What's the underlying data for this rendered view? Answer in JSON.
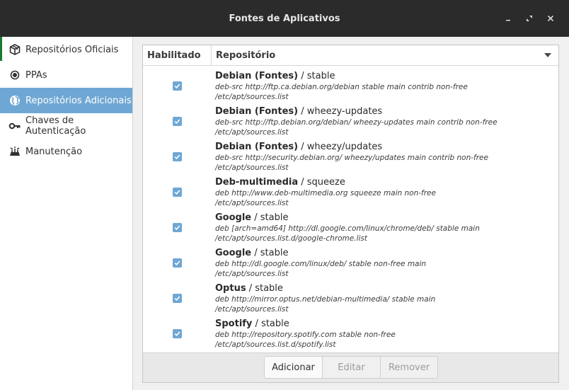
{
  "window": {
    "title": "Fontes de Aplicativos"
  },
  "sidebar": {
    "items": [
      {
        "label": "Repositórios Oficiais",
        "icon": "package-icon",
        "active": false
      },
      {
        "label": "PPAs",
        "icon": "ppa-dot-icon",
        "active": false
      },
      {
        "label": "Repositórios Adicionais",
        "icon": "globe-icon",
        "active": true
      },
      {
        "label": "Chaves de Autenticação",
        "icon": "key-icon",
        "active": false
      },
      {
        "label": "Manutenção",
        "icon": "maintenance-icon",
        "active": false
      }
    ]
  },
  "table": {
    "headers": {
      "enabled": "Habilitado",
      "repository": "Repositório"
    },
    "rows": [
      {
        "name": "Debian (Fontes)",
        "suffix": " / stable",
        "line1": "deb-src http://ftp.ca.debian.org/debian stable main contrib non-free",
        "line2": "/etc/apt/sources.list",
        "enabled": true
      },
      {
        "name": "Debian (Fontes)",
        "suffix": " / wheezy-updates",
        "line1": "deb-src http://ftp.debian.org/debian/ wheezy-updates main contrib non-free",
        "line2": "/etc/apt/sources.list",
        "enabled": true
      },
      {
        "name": "Debian (Fontes)",
        "suffix": " / wheezy/updates",
        "line1": "deb-src http://security.debian.org/ wheezy/updates main contrib non-free",
        "line2": "/etc/apt/sources.list",
        "enabled": true
      },
      {
        "name": "Deb-multimedia",
        "suffix": " / squeeze",
        "line1": "deb http://www.deb-multimedia.org squeeze main non-free",
        "line2": "/etc/apt/sources.list",
        "enabled": true
      },
      {
        "name": "Google",
        "suffix": " / stable",
        "line1": "deb [arch=amd64] http://dl.google.com/linux/chrome/deb/ stable main",
        "line2": "/etc/apt/sources.list.d/google-chrome.list",
        "enabled": true
      },
      {
        "name": "Google",
        "suffix": " / stable",
        "line1": "deb http://dl.google.com/linux/deb/ stable non-free main",
        "line2": "/etc/apt/sources.list",
        "enabled": true
      },
      {
        "name": "Optus",
        "suffix": " / stable",
        "line1": "deb http://mirror.optus.net/debian-multimedia/ stable main",
        "line2": "/etc/apt/sources.list",
        "enabled": true
      },
      {
        "name": "Spotify",
        "suffix": " / stable",
        "line1": "deb http://repository.spotify.com stable non-free",
        "line2": "/etc/apt/sources.list.d/spotify.list",
        "enabled": true
      }
    ]
  },
  "buttons": {
    "add": "Adicionar",
    "edit": "Editar",
    "remove": "Remover"
  },
  "colors": {
    "accent": "#6fa7d4",
    "titlebar": "#2b2b2b"
  }
}
